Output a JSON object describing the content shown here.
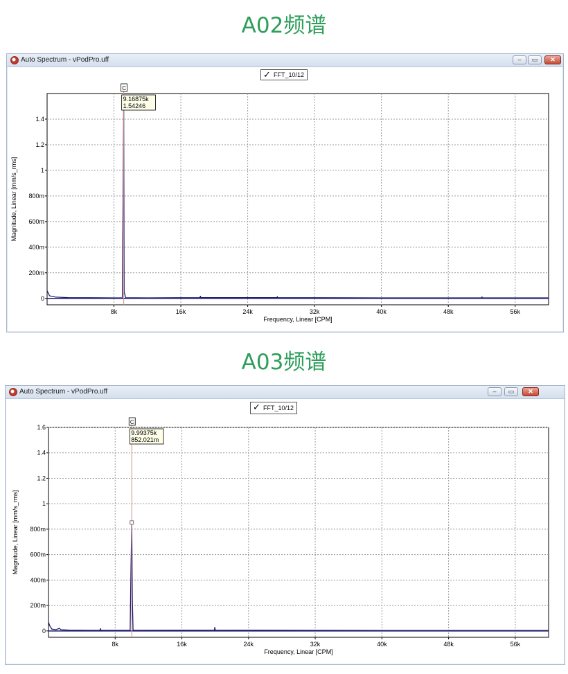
{
  "sections": [
    {
      "heading": "A02频谱",
      "window": {
        "title": "Auto Spectrum - vPodPro.uff",
        "buttons": {
          "minimize": "–",
          "restore": "▭",
          "close": "✕"
        },
        "legend": {
          "check": "✓",
          "label": "FFT_10/12"
        },
        "cursor": {
          "tag": "C",
          "x_label": "9.16875k",
          "y_label": "1.54246"
        }
      },
      "chart_data": {
        "type": "line",
        "xlabel": "Frequency, Linear [CPM]",
        "ylabel": "Magnitude, Linear [mm/s_rms]",
        "xlim": [
          0,
          60000
        ],
        "ylim": [
          -0.05,
          1.6
        ],
        "xticks": [
          8000,
          16000,
          24000,
          32000,
          40000,
          48000,
          56000
        ],
        "xtick_labels": [
          "8k",
          "16k",
          "24k",
          "32k",
          "40k",
          "48k",
          "56k"
        ],
        "yticks": [
          0,
          0.2,
          0.4,
          0.6,
          0.8,
          1.0,
          1.2,
          1.4
        ],
        "ytick_labels": [
          "0",
          "200m",
          "400m",
          "600m",
          "800m",
          "1",
          "1.2",
          "1.4"
        ],
        "grid": true,
        "cursor": {
          "x": 9168.75,
          "y": 1.54246
        },
        "series": [
          {
            "color": "#1c1c6e",
            "points": [
              [
                0,
                0.06
              ],
              [
                300,
                0.02
              ],
              [
                1000,
                0.01
              ],
              [
                2500,
                0.006
              ],
              [
                5000,
                0.005
              ],
              [
                8000,
                0.004
              ],
              [
                9000,
                0.004
              ],
              [
                9100,
                0.77
              ],
              [
                9168.75,
                1.54246
              ],
              [
                9220,
                0.05
              ],
              [
                9400,
                0.005
              ],
              [
                12000,
                0.004
              ],
              [
                18300,
                0.006
              ],
              [
                18340,
                0.02
              ],
              [
                18380,
                0.006
              ],
              [
                27500,
                0.006
              ],
              [
                27540,
                0.012
              ],
              [
                27580,
                0.006
              ],
              [
                40000,
                0.004
              ],
              [
                52000,
                0.004
              ],
              [
                52040,
                0.01
              ],
              [
                52080,
                0.004
              ],
              [
                60000,
                0.004
              ]
            ]
          }
        ]
      }
    },
    {
      "heading": "A03频谱",
      "window": {
        "title": "Auto Spectrum - vPodPro.uff",
        "buttons": {
          "minimize": "–",
          "restore": "▭",
          "close": "✕"
        },
        "legend": {
          "check": "✓",
          "label": "FFT_10/12"
        },
        "cursor": {
          "tag": "C",
          "x_label": "9.99375k",
          "y_label": "852.021m"
        }
      },
      "chart_data": {
        "type": "line",
        "xlabel": "Frequency, Linear [CPM]",
        "ylabel": "Magnitude, Linear [mm/s_rms]",
        "xlim": [
          0,
          60000
        ],
        "ylim": [
          -0.05,
          1.6
        ],
        "xticks": [
          8000,
          16000,
          24000,
          32000,
          40000,
          48000,
          56000
        ],
        "xtick_labels": [
          "8k",
          "16k",
          "24k",
          "32k",
          "40k",
          "48k",
          "56k"
        ],
        "yticks": [
          0,
          0.2,
          0.4,
          0.6,
          0.8,
          1.0,
          1.2,
          1.4,
          1.6
        ],
        "ytick_labels": [
          "0",
          "200m",
          "400m",
          "600m",
          "800m",
          "1",
          "1.2",
          "1.4",
          "1.6"
        ],
        "grid": true,
        "cursor": {
          "x": 9993.75,
          "y": 0.852021
        },
        "series": [
          {
            "color": "#1c1c6e",
            "points": [
              [
                0,
                0.07
              ],
              [
                150,
                0.04
              ],
              [
                400,
                0.015
              ],
              [
                900,
                0.01
              ],
              [
                1300,
                0.02
              ],
              [
                1500,
                0.01
              ],
              [
                2500,
                0.006
              ],
              [
                5000,
                0.005
              ],
              [
                6200,
                0.005
              ],
              [
                6240,
                0.02
              ],
              [
                6280,
                0.005
              ],
              [
                9800,
                0.005
              ],
              [
                9900,
                0.5
              ],
              [
                9993.75,
                0.852021
              ],
              [
                10060,
                0.25
              ],
              [
                10150,
                0.005
              ],
              [
                19900,
                0.006
              ],
              [
                19950,
                0.03
              ],
              [
                20000,
                0.006
              ],
              [
                40000,
                0.004
              ],
              [
                60000,
                0.004
              ]
            ]
          }
        ]
      }
    }
  ]
}
